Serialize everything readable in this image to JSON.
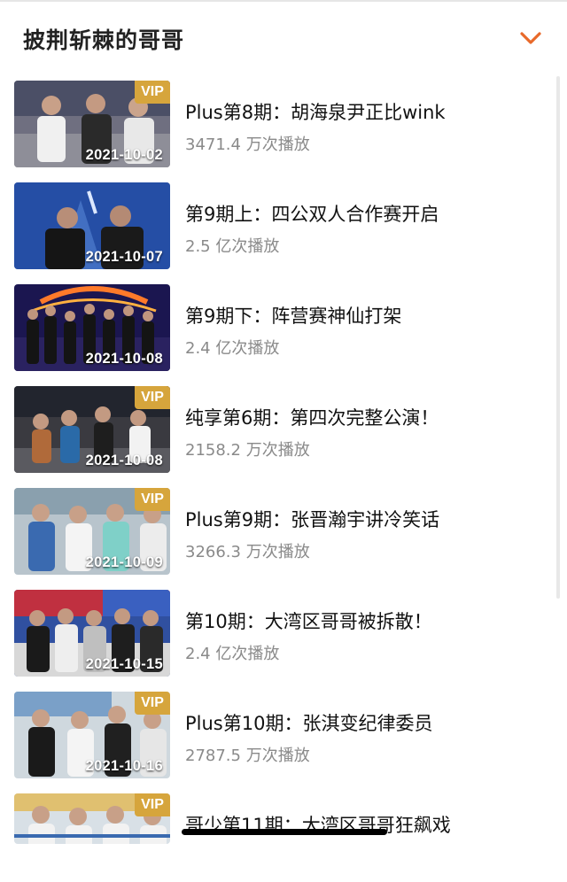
{
  "header": {
    "title": "披荆斩棘的哥哥",
    "expand_icon": "chevron-down-icon",
    "accent_color": "#e8692a"
  },
  "colors": {
    "vip_badge": "#d6a53c",
    "views_text": "#8a8a8a"
  },
  "episodes": [
    {
      "title": "Plus第8期：胡海泉尹正比wink",
      "views": "3471.4 万次播放",
      "date": "2021-10-02",
      "vip": "VIP"
    },
    {
      "title": "第9期上：四公双人合作赛开启",
      "views": "2.5 亿次播放",
      "date": "2021-10-07",
      "vip": ""
    },
    {
      "title": "第9期下：阵营赛神仙打架",
      "views": "2.4 亿次播放",
      "date": "2021-10-08",
      "vip": ""
    },
    {
      "title": "纯享第6期：第四次完整公演！",
      "views": "2158.2 万次播放",
      "date": "2021-10-08",
      "vip": "VIP"
    },
    {
      "title": "Plus第9期：张晋瀚宇讲冷笑话",
      "views": "3266.3 万次播放",
      "date": "2021-10-09",
      "vip": "VIP"
    },
    {
      "title": "第10期：大湾区哥哥被拆散！",
      "views": "2.4 亿次播放",
      "date": "2021-10-15",
      "vip": ""
    },
    {
      "title": "Plus第10期：张淇变纪律委员",
      "views": "2787.5 万次播放",
      "date": "2021-10-16",
      "vip": "VIP"
    },
    {
      "title": "哥少第11期：大湾区哥哥狂飙戏",
      "views": "",
      "date": "",
      "vip": "VIP"
    }
  ]
}
